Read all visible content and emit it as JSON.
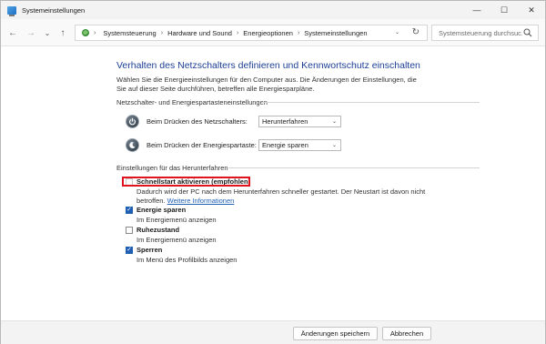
{
  "window": {
    "title": "Systemeinstellungen",
    "controls": {
      "minimize": "—",
      "maximize": "☐",
      "close": "✕"
    }
  },
  "nav": {
    "back": "←",
    "forward": "→",
    "dropdown": "⌄",
    "up": "↑",
    "breadcrumb": [
      "Systemsteuerung",
      "Hardware und Sound",
      "Energieoptionen",
      "Systemeinstellungen"
    ],
    "breadcrumb_sep": "›",
    "address_dropdown": "⌄",
    "refresh": "↻",
    "search_placeholder": "Systemsteuerung durchsuc..."
  },
  "main": {
    "title": "Verhalten des Netzschalters definieren und Kennwortschutz einschalten",
    "intro": "Wählen Sie die Energieeinstellungen für den Computer aus. Die Änderungen der Einstellungen, die Sie auf dieser Seite durchführen, betreffen alle Energiesparpläne.",
    "power_section": {
      "label": "Netzschalter- und Energiespartasteneinstellungen",
      "rows": [
        {
          "label": "Beim Drücken des Netzschalters:",
          "value": "Herunterfahren",
          "icon": "power-icon"
        },
        {
          "label": "Beim Drücken der Energiespartaste:",
          "value": "Energie sparen",
          "icon": "sleep-icon"
        }
      ]
    },
    "shutdown_section": {
      "label": "Einstellungen für das Herunterfahren",
      "options": [
        {
          "label": "Schnellstart aktivieren (empfohlen)",
          "desc": "Dadurch wird der PC nach dem Herunterfahren schneller gestartet. Der Neustart ist davon nicht betroffen.",
          "link": "Weitere Informationen",
          "checked": false
        },
        {
          "label": "Energie sparen",
          "desc": "Im Energiemenü anzeigen",
          "checked": true
        },
        {
          "label": "Ruhezustand",
          "desc": "Im Energiemenü anzeigen",
          "checked": false
        },
        {
          "label": "Sperren",
          "desc": "Im Menü des Profilbilds anzeigen",
          "checked": true
        }
      ]
    },
    "highlight_color": "#e0141e"
  },
  "footer": {
    "save": "Änderungen speichern",
    "cancel": "Abbrechen"
  }
}
